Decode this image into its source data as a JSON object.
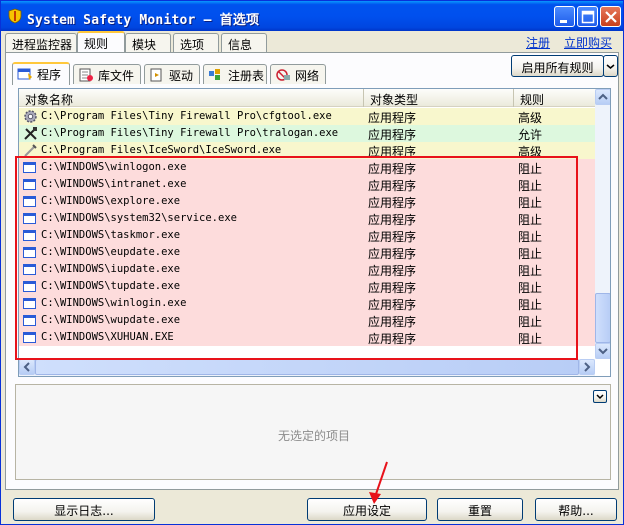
{
  "window": {
    "title": "System Safety Monitor — 首选项",
    "buttons": [
      "minimize",
      "maximize",
      "close"
    ]
  },
  "top_tabs": [
    {
      "label": "进程监控器",
      "active": false
    },
    {
      "label": "规则",
      "active": true
    },
    {
      "label": "模块",
      "active": false
    },
    {
      "label": "选项",
      "active": false
    },
    {
      "label": "信息",
      "active": false
    }
  ],
  "top_links": {
    "register": "注册",
    "buy": "立即购买"
  },
  "sub_tabs": [
    {
      "label": "程序",
      "icon": "program-icon",
      "active": true
    },
    {
      "label": "库文件",
      "icon": "library-icon",
      "active": false
    },
    {
      "label": "驱动",
      "icon": "driver-icon",
      "active": false
    },
    {
      "label": "注册表",
      "icon": "registry-icon",
      "active": false
    },
    {
      "label": "网络",
      "icon": "network-icon",
      "active": false
    }
  ],
  "enable_all_button": "启用所有规则",
  "table": {
    "columns": [
      "对象名称",
      "对象类型",
      "规则"
    ],
    "rows": [
      {
        "name": "C:\\Program Files\\Tiny Firewall Pro\\cfgtool.exe",
        "type": "应用程序",
        "rule": "高级",
        "icon": "gear-icon",
        "bg": "#f8f7cd"
      },
      {
        "name": "C:\\Program Files\\Tiny Firewall Pro\\tralogan.exe",
        "type": "应用程序",
        "rule": "允许",
        "icon": "tools-icon",
        "bg": "#ddf8de"
      },
      {
        "name": "C:\\Program Files\\IceSword\\IceSword.exe",
        "type": "应用程序",
        "rule": "高级",
        "icon": "sword-icon",
        "bg": "#f8f7cd"
      },
      {
        "name": "C:\\WINDOWS\\winlogon.exe",
        "type": "应用程序",
        "rule": "阻止",
        "icon": "window-icon",
        "bg": "#fddcdc"
      },
      {
        "name": "C:\\WINDOWS\\intranet.exe",
        "type": "应用程序",
        "rule": "阻止",
        "icon": "window-icon",
        "bg": "#fddcdc"
      },
      {
        "name": "C:\\WINDOWS\\explore.exe",
        "type": "应用程序",
        "rule": "阻止",
        "icon": "window-icon",
        "bg": "#fddcdc"
      },
      {
        "name": "C:\\WINDOWS\\system32\\service.exe",
        "type": "应用程序",
        "rule": "阻止",
        "icon": "window-icon",
        "bg": "#fddcdc"
      },
      {
        "name": "C:\\WINDOWS\\taskmor.exe",
        "type": "应用程序",
        "rule": "阻止",
        "icon": "window-icon",
        "bg": "#fddcdc"
      },
      {
        "name": "C:\\WINDOWS\\eupdate.exe",
        "type": "应用程序",
        "rule": "阻止",
        "icon": "window-icon",
        "bg": "#fddcdc"
      },
      {
        "name": "C:\\WINDOWS\\iupdate.exe",
        "type": "应用程序",
        "rule": "阻止",
        "icon": "window-icon",
        "bg": "#fddcdc"
      },
      {
        "name": "C:\\WINDOWS\\tupdate.exe",
        "type": "应用程序",
        "rule": "阻止",
        "icon": "window-icon",
        "bg": "#fddcdc"
      },
      {
        "name": "C:\\WINDOWS\\winlogin.exe",
        "type": "应用程序",
        "rule": "阻止",
        "icon": "window-icon",
        "bg": "#fddcdc"
      },
      {
        "name": "C:\\WINDOWS\\wupdate.exe",
        "type": "应用程序",
        "rule": "阻止",
        "icon": "window-icon",
        "bg": "#fddcdc"
      },
      {
        "name": "C:\\WINDOWS\\XUHUAN.EXE",
        "type": "应用程序",
        "rule": "阻止",
        "icon": "window-icon",
        "bg": "#fddcdc"
      }
    ]
  },
  "detail": {
    "empty_text": "无选定的项目"
  },
  "bottom_buttons": {
    "show_log": "显示日志...",
    "apply": "应用设定",
    "reset": "重置",
    "help": "帮助..."
  },
  "colors": {
    "highlight_box": "#e8121a",
    "title_bar": "#0050ee"
  }
}
